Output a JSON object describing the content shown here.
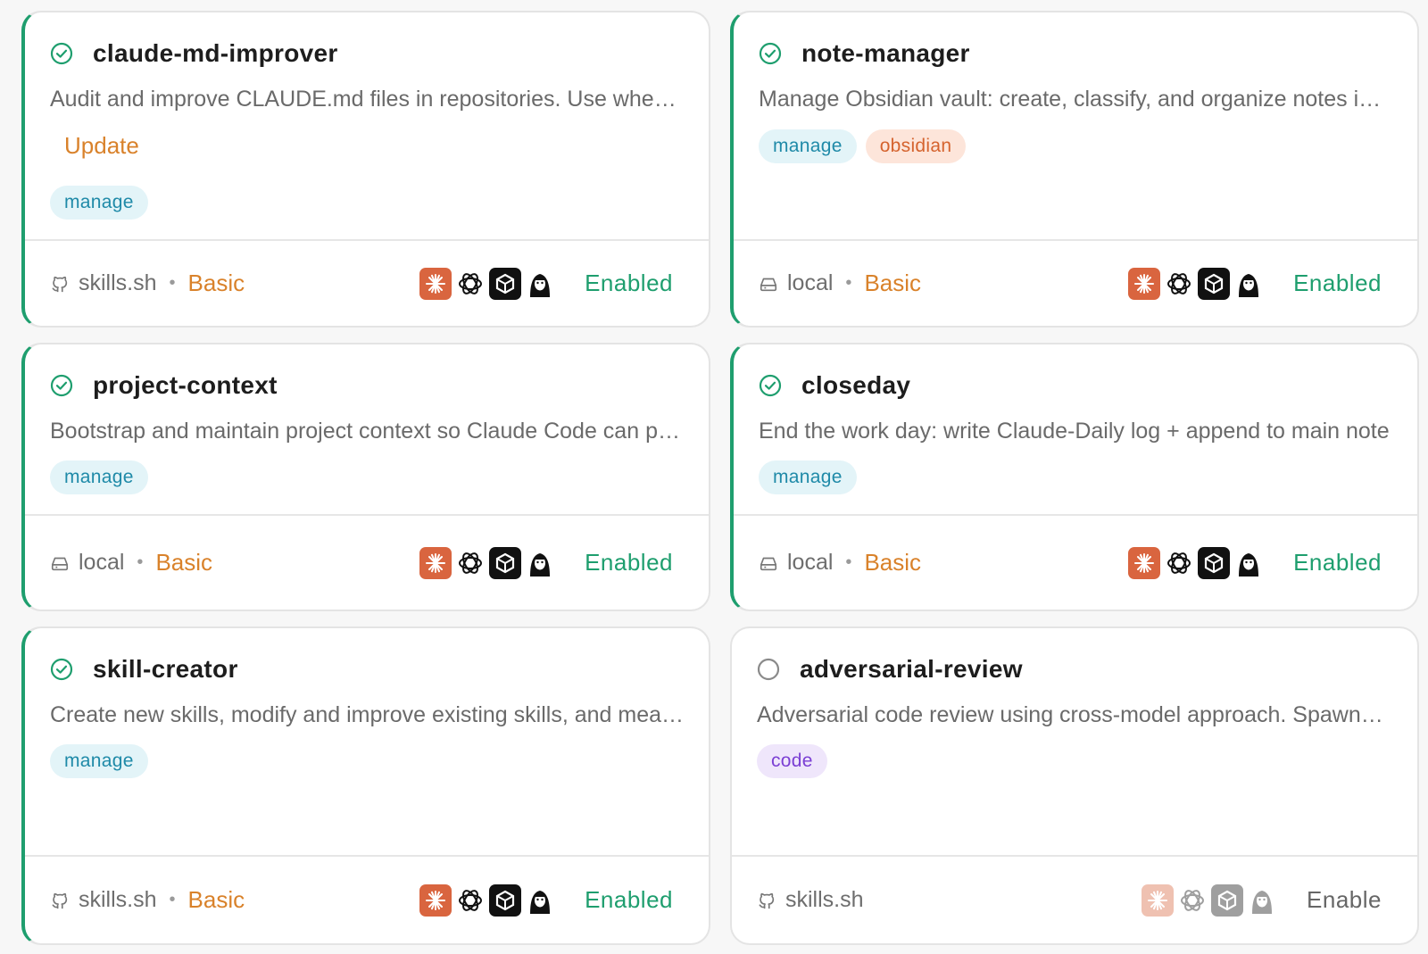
{
  "colors": {
    "enabled_accent": "#1e9e6e",
    "update_orange": "#d9822b",
    "tag_manage_bg": "#e3f4f8",
    "tag_obsidian_bg": "#fde5da",
    "tag_code_bg": "#efe6fb"
  },
  "agent_icons": [
    "claude-icon",
    "openai-icon",
    "cube-agent-icon",
    "avatar-agent-icon"
  ],
  "cards": [
    {
      "name": "claude-md-improver",
      "description": "Audit and improve CLAUDE.md files in repositories. Use when user asks to check, audit, update",
      "update_label": "Update",
      "tags": [
        "manage"
      ],
      "source": "skills.sh",
      "source_icon": "github-icon",
      "level": "Basic",
      "status": "Enabled"
    },
    {
      "name": "note-manager",
      "description": "Manage Obsidian vault: create, classify, and organize notes in the vault",
      "tags": [
        "manage",
        "obsidian"
      ],
      "source": "local",
      "source_icon": "drive-icon",
      "level": "Basic",
      "status": "Enabled"
    },
    {
      "name": "project-context",
      "description": "Bootstrap and maintain project context so Claude Code can pick up where it left off",
      "tags": [
        "manage"
      ],
      "source": "local",
      "source_icon": "drive-icon",
      "level": "Basic",
      "status": "Enabled"
    },
    {
      "name": "closeday",
      "description": "End the work day: write Claude-Daily log + append to main note",
      "tags": [
        "manage"
      ],
      "source": "local",
      "source_icon": "drive-icon",
      "level": "Basic",
      "status": "Enabled"
    },
    {
      "name": "skill-creator",
      "description": "Create new skills, modify and improve existing skills, and measure skill performance",
      "tags": [
        "manage"
      ],
      "source": "skills.sh",
      "source_icon": "github-icon",
      "level": "Basic",
      "status": "Enabled"
    },
    {
      "name": "adversarial-review",
      "description": "Adversarial code review using cross-model approach. Spawns reviewers on the opposite model",
      "tags": [
        "code"
      ],
      "source": "skills.sh",
      "source_icon": "github-icon",
      "level": "",
      "status": "Enable"
    }
  ]
}
